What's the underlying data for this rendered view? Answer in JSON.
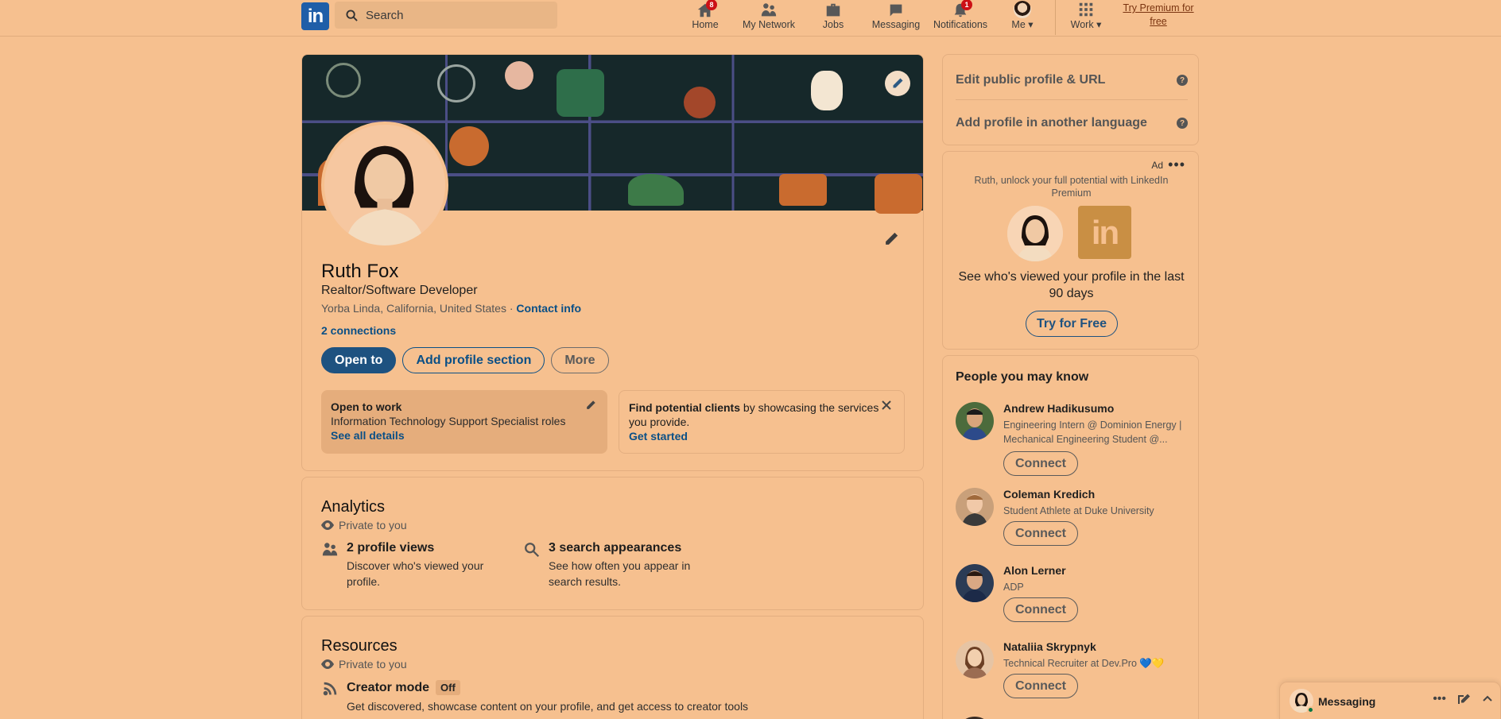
{
  "nav": {
    "logo": "in",
    "search_placeholder": "Search",
    "items": [
      {
        "label": "Home",
        "badge": "8"
      },
      {
        "label": "My Network",
        "badge": ""
      },
      {
        "label": "Jobs",
        "badge": ""
      },
      {
        "label": "Messaging",
        "badge": ""
      },
      {
        "label": "Notifications",
        "badge": "1"
      },
      {
        "label": "Me",
        "badge": ""
      },
      {
        "label": "Work",
        "badge": ""
      }
    ],
    "premium": "Try Premium for free"
  },
  "profile": {
    "name": "Ruth Fox",
    "headline": "Realtor/Software Developer",
    "location": "Yorba Linda, California, United States",
    "separator": "·",
    "contact_info": "Contact info",
    "connections": "2 connections",
    "buttons": {
      "open_to": "Open to",
      "add_section": "Add profile section",
      "more": "More"
    },
    "open_to_work": {
      "title": "Open to work",
      "roles": "Information Technology Support Specialist roles",
      "link": "See all details"
    },
    "find_clients": {
      "bold": "Find potential clients",
      "rest": " by showcasing the services you provide.",
      "link": "Get started"
    }
  },
  "analytics": {
    "title": "Analytics",
    "private": "Private to you",
    "stats": [
      {
        "heading": "2 profile views",
        "sub": "Discover who's viewed your profile."
      },
      {
        "heading": "3 search appearances",
        "sub": "See how often you appear in search results."
      }
    ]
  },
  "resources": {
    "title": "Resources",
    "private": "Private to you",
    "creator_mode": "Creator mode",
    "creator_status": "Off",
    "creator_desc": "Get discovered, showcase content on your profile, and get access to creator tools"
  },
  "right_rail": {
    "edit_url": "Edit public profile & URL",
    "add_language": "Add profile in another language",
    "ad": {
      "label": "Ad",
      "text": "Ruth, unlock your full potential with LinkedIn Premium",
      "logo": "in",
      "subtext": "See who's viewed your profile in the last 90 days",
      "button": "Try for Free"
    },
    "pymk_title": "People you may know",
    "people": [
      {
        "name": "Andrew Hadikusumo",
        "desc": "Engineering Intern @ Dominion Energy | Mechanical Engineering Student @...",
        "button": "Connect"
      },
      {
        "name": "Coleman Kredich",
        "desc": "Student Athlete at Duke University",
        "button": "Connect"
      },
      {
        "name": "Alon Lerner",
        "desc": "ADP",
        "button": "Connect"
      },
      {
        "name": "Nataliia Skrypnyk",
        "desc": "Technical Recruiter at Dev.Pro 💙💛",
        "button": "Connect"
      }
    ]
  },
  "messaging": {
    "label": "Messaging"
  },
  "colors": {
    "accent": "#0a4f86",
    "primary_button": "#1e5280",
    "badge": "#cc1016",
    "background": "#f6c08f"
  }
}
